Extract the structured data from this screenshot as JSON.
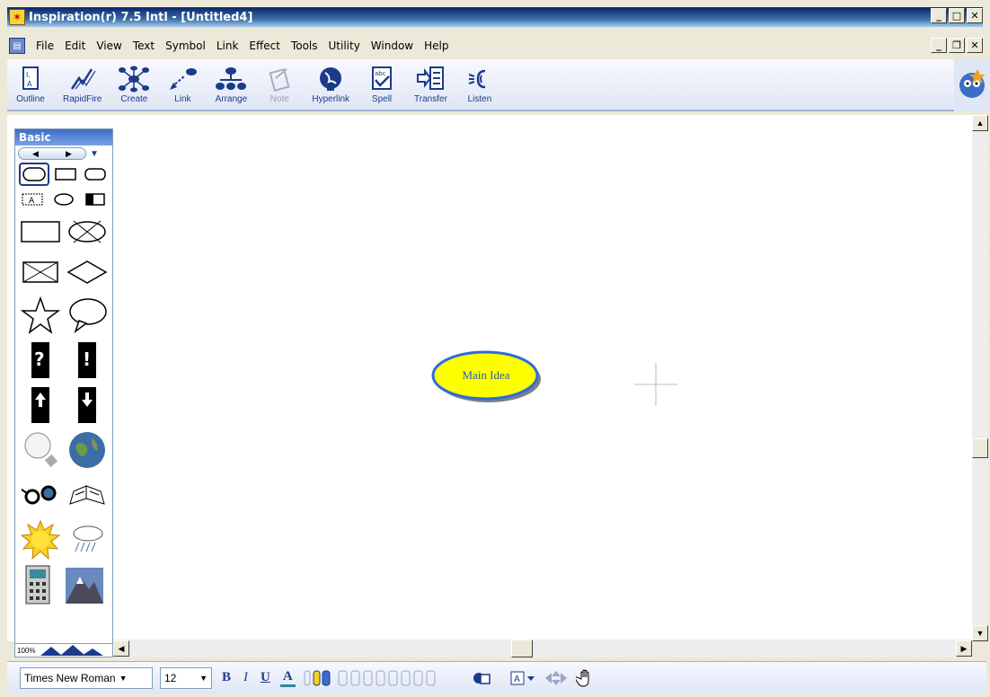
{
  "window": {
    "title": "Inspiration(r) 7.5 Intl - [Untitled4]"
  },
  "menu": {
    "items": [
      "File",
      "Edit",
      "View",
      "Text",
      "Symbol",
      "Link",
      "Effect",
      "Tools",
      "Utility",
      "Window",
      "Help"
    ]
  },
  "toolbar": {
    "buttons": [
      {
        "label": "Outline",
        "icon": "outline-icon"
      },
      {
        "label": "RapidFire",
        "icon": "rapidfire-icon"
      },
      {
        "label": "Create",
        "icon": "create-icon"
      },
      {
        "label": "Link",
        "icon": "link-icon"
      },
      {
        "label": "Arrange",
        "icon": "arrange-icon"
      },
      {
        "label": "Note",
        "icon": "note-icon",
        "disabled": true
      },
      {
        "label": "Hyperlink",
        "icon": "hyperlink-icon"
      },
      {
        "label": "Spell",
        "icon": "spell-icon"
      },
      {
        "label": "Transfer",
        "icon": "transfer-icon"
      },
      {
        "label": "Listen",
        "icon": "listen-icon"
      }
    ]
  },
  "palette": {
    "title": "Basic",
    "zoom": "100%"
  },
  "diagram": {
    "main_idea": "Main Idea",
    "colors": {
      "fill": "#ffff00",
      "stroke": "#2a6ed8",
      "text": "#2a5caa"
    }
  },
  "formatbar": {
    "font": "Times New Roman",
    "size": "12",
    "bold": "B",
    "italic": "I",
    "underline": "U",
    "color": "A"
  },
  "colors": {
    "title_gradient_start": "#0a246a",
    "accent": "#1c3a8a"
  }
}
